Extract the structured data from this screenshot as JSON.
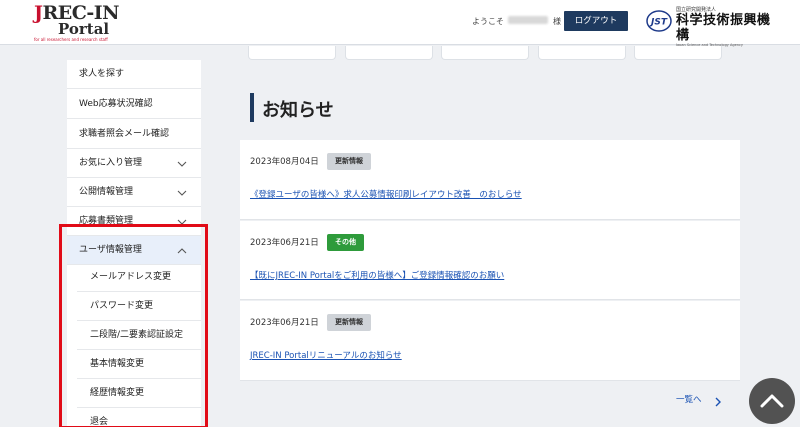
{
  "header": {
    "logo": {
      "name": "JREC-IN",
      "portal": "Portal",
      "tagline": "for all researchers and research staff"
    },
    "welcome": "ようこそ",
    "honorific": "様",
    "logout_label": "ログアウト",
    "org": {
      "small": "国立研究開発法人",
      "name": "科学技術振興機構",
      "english": "Japan Science and Technology Agency",
      "mark": "JST"
    }
  },
  "sidebar": {
    "items": [
      {
        "label": "求人を探す"
      },
      {
        "label": "Web応募状況確認"
      },
      {
        "label": "求職者照会メール確認"
      },
      {
        "label": "お気に入り管理"
      },
      {
        "label": "公開情報管理"
      },
      {
        "label": "応募書類管理"
      },
      {
        "label": "ユーザ情報管理"
      }
    ],
    "subitems": [
      {
        "label": "メールアドレス変更"
      },
      {
        "label": "パスワード変更"
      },
      {
        "label": "二段階/二要素認証設定"
      },
      {
        "label": "基本情報変更"
      },
      {
        "label": "経歴情報変更"
      },
      {
        "label": "退会"
      }
    ]
  },
  "main": {
    "title": "お知らせ",
    "news": [
      {
        "date": "2023年08月04日",
        "tag": "更新情報",
        "tag_color": "#cfd3d8",
        "link": "《登録ユーザの皆様へ》求人公募情報印刷レイアウト改善　のおしらせ"
      },
      {
        "date": "2023年06月21日",
        "tag": "その他",
        "tag_color": "#2e9b3b",
        "link": "【既にJREC-IN Portalをご利用の皆様へ】ご登録情報確認のお願い"
      },
      {
        "date": "2023年06月21日",
        "tag": "更新情報",
        "tag_color": "#cfd3d8",
        "link": "JREC-IN Portalリニューアルのお知らせ"
      }
    ],
    "more_label": "一覧へ"
  },
  "colors": {
    "accent": "#1e3a5f",
    "link": "#1a52b3",
    "highlight": "#e10b17",
    "active_bg": "#e8effa"
  },
  "icons": {
    "chevron": "chevron-down-icon",
    "chevron_up": "chevron-up-icon",
    "more": "chevron-right-icon",
    "pagetop": "arrow-up-icon"
  }
}
